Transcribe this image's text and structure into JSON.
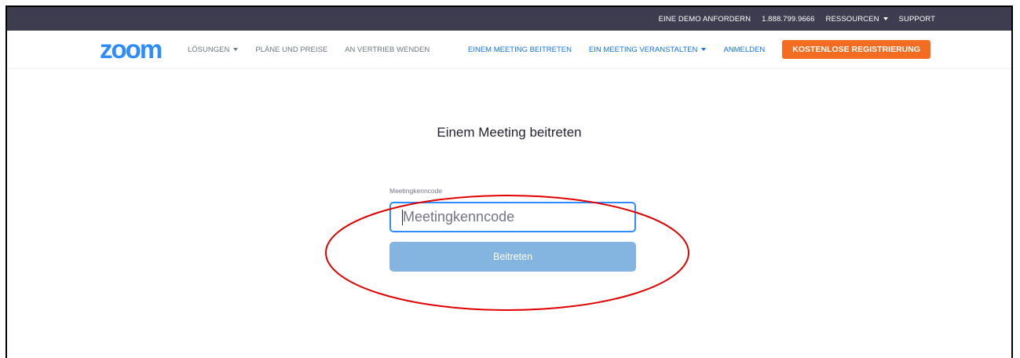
{
  "topbar": {
    "links": [
      {
        "label": "EINE DEMO ANFORDERN"
      },
      {
        "label": "1.888.799.9666"
      },
      {
        "label": "RESSOURCEN"
      },
      {
        "label": "SUPPORT"
      }
    ]
  },
  "brand": {
    "logo_text": "zoom",
    "logo_color": "#2d8cff"
  },
  "nav": {
    "left": [
      {
        "label": "LÖSUNGEN"
      },
      {
        "label": "PLÄNE UND PREISE"
      },
      {
        "label": "AN VERTRIEB WENDEN"
      }
    ],
    "right": [
      {
        "label": "EINEM MEETING BEITRETEN"
      },
      {
        "label": "EIN MEETING VERANSTALTEN"
      },
      {
        "label": "ANMELDEN"
      }
    ],
    "signup_label": "KOSTENLOSE REGISTRIERUNG",
    "signup_color": "#f26d21"
  },
  "main": {
    "title": "Einem Meeting beitreten",
    "field_label": "Meetingkenncode",
    "input_placeholder": "Meetingkenncode",
    "input_value": "",
    "join_label": "Beitreten"
  },
  "annotation": {
    "shape": "ellipse",
    "color": "#e00000"
  },
  "icons": [
    "chevron-down-icon"
  ]
}
